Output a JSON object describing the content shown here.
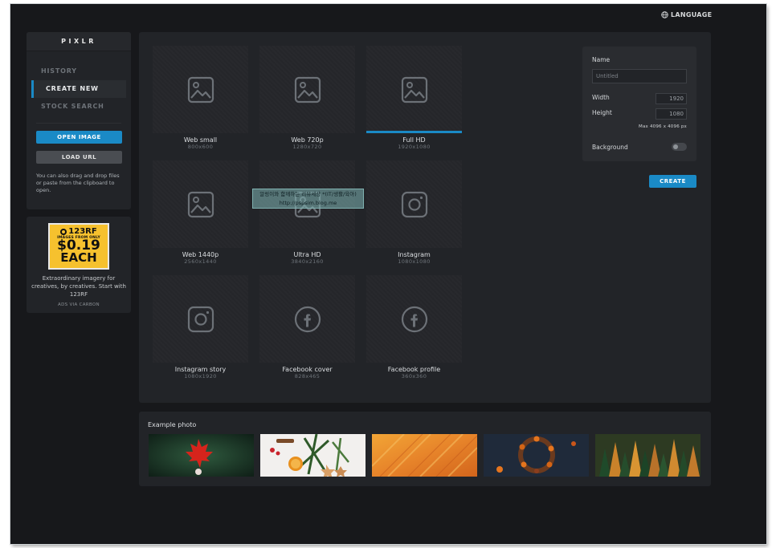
{
  "header": {
    "language_label": "LANGUAGE"
  },
  "sidebar": {
    "logo": "PIXLR",
    "nav": [
      {
        "label": "HISTORY",
        "active": false
      },
      {
        "label": "CREATE NEW",
        "active": true
      },
      {
        "label": "STOCK SEARCH",
        "active": false
      }
    ],
    "open_image_label": "OPEN IMAGE",
    "load_url_label": "LOAD URL",
    "hint": "You can also drag and drop files or paste from the clipboard to open."
  },
  "ad": {
    "brand": "123RF",
    "small_text": "IMAGES FROM ONLY",
    "price": "$0.19",
    "each": "EACH",
    "tagline": "Extraordinary imagery for creatives, by creatives. Start with 123RF",
    "via": "ADS VIA CARBON"
  },
  "templates": [
    {
      "name": "Web small",
      "size": "800x600",
      "icon": "image-icon"
    },
    {
      "name": "Web 720p",
      "size": "1280x720",
      "icon": "image-icon"
    },
    {
      "name": "Full HD",
      "size": "1920x1080",
      "icon": "image-icon",
      "selected": true
    },
    {
      "name": "Web 1440p",
      "size": "2560x1440",
      "icon": "image-icon"
    },
    {
      "name": "Ultra HD",
      "size": "3840x2160",
      "icon": "image-icon"
    },
    {
      "name": "Instagram",
      "size": "1080x1080",
      "icon": "instagram-icon"
    },
    {
      "name": "Instagram story",
      "size": "1080x1920",
      "icon": "instagram-icon"
    },
    {
      "name": "Facebook cover",
      "size": "828x465",
      "icon": "facebook-icon"
    },
    {
      "name": "Facebook profile",
      "size": "360x360",
      "icon": "facebook-icon"
    }
  ],
  "watermark": {
    "line1": "알링이와 함께하는 리뷰세상 *(IT/생활/육아)",
    "line2": "http://pspsim.blog.me"
  },
  "properties": {
    "name_label": "Name",
    "name_placeholder": "Untitled",
    "width_label": "Width",
    "width_value": "1920",
    "height_label": "Height",
    "height_value": "1080",
    "max_note": "Max 4096 x 4096 px",
    "background_label": "Background",
    "create_label": "CREATE"
  },
  "examples": {
    "title": "Example photo"
  },
  "colors": {
    "accent": "#1a8ac6",
    "panel": "#222428",
    "background": "#17181b"
  }
}
